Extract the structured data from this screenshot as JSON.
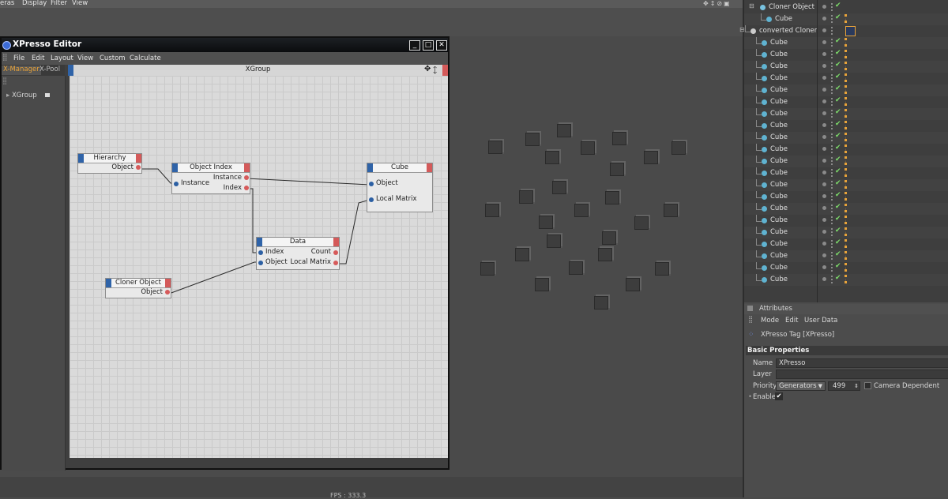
{
  "top_menu": [
    "eras",
    "Display",
    "Filter",
    "View"
  ],
  "fps_text": "FPS : 333.3",
  "xpresso_window": {
    "title": "XPresso Editor",
    "menu": [
      "File",
      "Edit",
      "Layout",
      "View",
      "Custom",
      "Calculate"
    ],
    "tabs": [
      "X-Manager",
      "X-Pool"
    ],
    "tree_item": "XGroup",
    "group_title": "XGroup"
  },
  "nodes": {
    "hierarchy": {
      "title": "Hierarchy",
      "out": "Object"
    },
    "object_index": {
      "title": "Object Index",
      "in": "Instance",
      "out1": "Instance",
      "out2": "Index"
    },
    "cube": {
      "title": "Cube",
      "in1": "Object",
      "in2": "Local Matrix"
    },
    "data": {
      "title": "Data",
      "in1": "Index",
      "in2": "Object",
      "out1": "Count",
      "out2": "Local Matrix"
    },
    "cloner": {
      "title": "Cloner Object",
      "out": "Object"
    }
  },
  "object_manager": {
    "rows": [
      {
        "name": "Cloner Object"
      },
      {
        "name": "Cube"
      },
      {
        "name": "converted Cloner"
      },
      {
        "name": "Cube"
      },
      {
        "name": "Cube"
      },
      {
        "name": "Cube"
      },
      {
        "name": "Cube"
      },
      {
        "name": "Cube"
      },
      {
        "name": "Cube"
      },
      {
        "name": "Cube"
      },
      {
        "name": "Cube"
      },
      {
        "name": "Cube"
      },
      {
        "name": "Cube"
      },
      {
        "name": "Cube"
      },
      {
        "name": "Cube"
      },
      {
        "name": "Cube"
      },
      {
        "name": "Cube"
      },
      {
        "name": "Cube"
      },
      {
        "name": "Cube"
      },
      {
        "name": "Cube"
      },
      {
        "name": "Cube"
      },
      {
        "name": "Cube"
      },
      {
        "name": "Cube"
      },
      {
        "name": "Cube"
      }
    ],
    "check_glyph": "✔"
  },
  "attributes": {
    "title": "Attributes",
    "menu": [
      "Mode",
      "Edit",
      "User Data"
    ],
    "object_label": "XPresso Tag [XPresso]",
    "section": "Basic Properties",
    "name_label": "Name",
    "name_value": "XPresso",
    "layer_label": "Layer",
    "priority_label": "Priority",
    "priority_value": "Generators",
    "priority_number": "499",
    "camera_dependent": "Camera Dependent",
    "enable_label": "Enable",
    "enable_check": "✔"
  },
  "colors": {
    "port_in": "#2c5fa3",
    "port_out": "#d65a5a",
    "tab_active": "#e8a33a"
  }
}
